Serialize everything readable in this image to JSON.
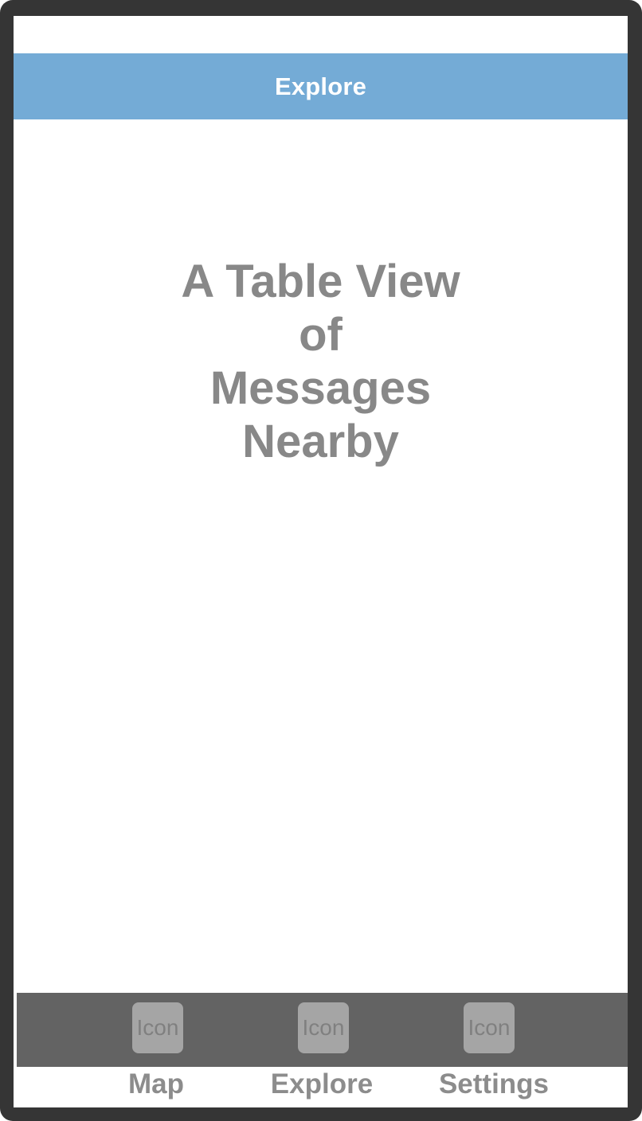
{
  "nav_bar": {
    "title": "Explore",
    "background_color": "#74abd6"
  },
  "main": {
    "placeholder_text": "A Table View\nof\nMessages\nNearby"
  },
  "tab_bar": {
    "background_color": "#636363",
    "tabs": [
      {
        "icon_text": "Icon",
        "label": "Map",
        "icon": "map-icon"
      },
      {
        "icon_text": "Icon",
        "label": "Explore",
        "icon": "explore-icon"
      },
      {
        "icon_text": "Icon",
        "label": "Settings",
        "icon": "settings-icon"
      }
    ]
  }
}
